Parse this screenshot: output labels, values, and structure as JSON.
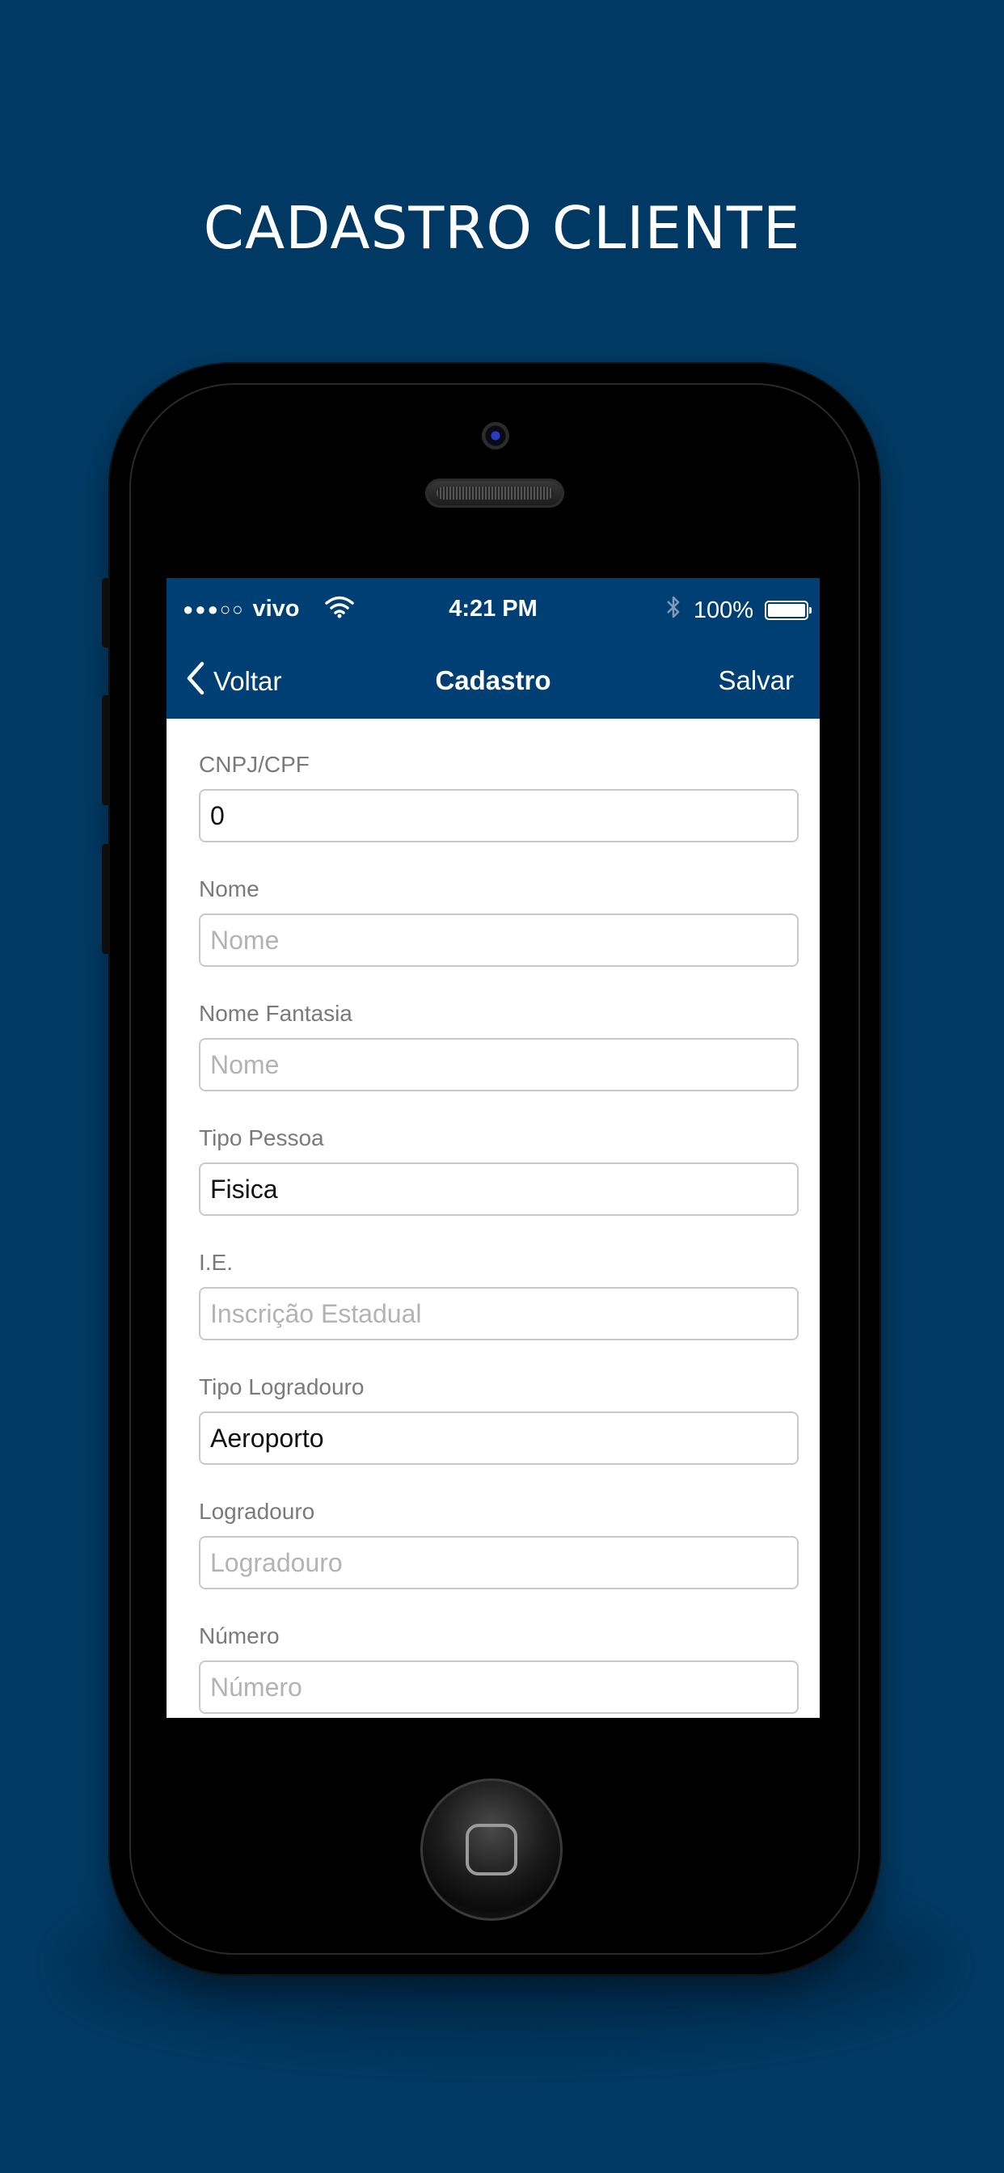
{
  "headline": "CADASTRO CLIENTE",
  "status_bar": {
    "signal": "●●●○○",
    "carrier": "vivo",
    "time": "4:21 PM",
    "battery": "100%",
    "icons": [
      "wifi-icon",
      "bluetooth-icon",
      "battery-icon"
    ]
  },
  "nav": {
    "back_label": "Voltar",
    "title": "Cadastro",
    "save_label": "Salvar"
  },
  "form": {
    "fields": [
      {
        "label": "CNPJ/CPF",
        "value": "0",
        "placeholder": ""
      },
      {
        "label": "Nome",
        "value": "",
        "placeholder": "Nome"
      },
      {
        "label": "Nome Fantasia",
        "value": "",
        "placeholder": "Nome"
      },
      {
        "label": "Tipo Pessoa",
        "value": "Fisica",
        "placeholder": ""
      },
      {
        "label": "I.E.",
        "value": "",
        "placeholder": "Inscrição Estadual"
      },
      {
        "label": "Tipo Logradouro",
        "value": "Aeroporto",
        "placeholder": ""
      },
      {
        "label": "Logradouro",
        "value": "",
        "placeholder": "Logradouro"
      },
      {
        "label": "Número",
        "value": "",
        "placeholder": "Número"
      }
    ]
  },
  "colors": {
    "background": "#003a64",
    "nav_bar": "#003f73",
    "input_border": "#c9c9c9",
    "label": "#7a7a7a"
  }
}
